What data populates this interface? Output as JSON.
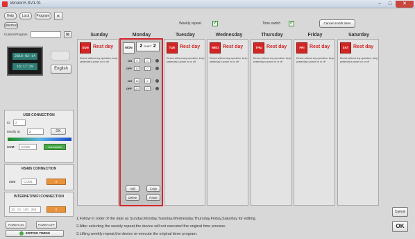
{
  "window": {
    "title": "VersionY-SV1.01",
    "min": "–",
    "max": "□",
    "close": "✕"
  },
  "left": {
    "help": "Help",
    "lock": "Lock",
    "program": "Program",
    "collapse": "«",
    "elements": "(Wetfox)",
    "current_program_label": "Current Program",
    "current_program_value": "",
    "current_program_btn": "⊠",
    "date": "2016-02-14",
    "time": "16:17:29",
    "gray_btn": "",
    "english": "English"
  },
  "usb": {
    "title": "USB CONNECTION",
    "id_label": "ID",
    "id_value": "2",
    "modify_label": "Modify ID",
    "modify_value": "2",
    "ok": "OK",
    "com_label": "COM",
    "com_value": "COM6",
    "connect": "Connected"
  },
  "rs485": {
    "title": "RS485 CONNECTION",
    "com_label": "com",
    "com_value": "COM1",
    "button": "0"
  },
  "wifi": {
    "title": "INTERNET/WIFI CONNECTION",
    "ip": "10 . 10 . 100 . 254",
    "button": "0"
  },
  "bottom_left": {
    "power_on": "POWER ON",
    "power_off": "POWER OFF",
    "editing_timing": "EDITING TIMING"
  },
  "top": {
    "weekly_repeat": "Weekly repeat",
    "time_switch": "Time switch",
    "cancel_week": "Cancel month timer"
  },
  "days": [
    {
      "name": "Sunday",
      "badge": "SUN",
      "rest": "Rest day",
      "desc": "Device without any operation, keep yesterday's power on or off"
    },
    {
      "name": "Monday",
      "badge": "MON",
      "tab_num": "2",
      "tab_sub": "SHIFT",
      "tab_num2": "2"
    },
    {
      "name": "Tuesday",
      "badge": "TUE",
      "rest": "Rest day",
      "desc": "Device without any operation, keep yesterday's power on or off"
    },
    {
      "name": "Wednesday",
      "badge": "WED",
      "rest": "Rest day",
      "desc": "Device without any operation, keep yesterday's power on or off"
    },
    {
      "name": "Thursday",
      "badge": "THU",
      "rest": "Rest day",
      "desc": "Device without any operation, keep yesterday's power on or off"
    },
    {
      "name": "Friday",
      "badge": "FRI",
      "rest": "Rest day",
      "desc": "Device without any operation, keep yesterday's power on or off"
    },
    {
      "name": "Saturday",
      "badge": "SAT",
      "rest": "Rest day",
      "desc": "Device without any operation, keep yesterday's power on or off"
    }
  ],
  "monday_times": [
    {
      "label": "ON",
      "h": "0",
      "m": "0"
    },
    {
      "label": "OFF",
      "h": "12",
      "m": "0"
    },
    {
      "label": "ON",
      "h": "14",
      "m": "0"
    },
    {
      "label": "OFF",
      "h": "22",
      "m": "0"
    }
  ],
  "monday_buttons": {
    "add": "Add",
    "copy": "Copy",
    "delete": "Delete",
    "paste": "Paste"
  },
  "notes": [
    "1.Follow in order of the date as Sunday,Monday,Tuesday,Wednesday,Thursday,Friday,Saturday for editing.",
    "2.After selecting the weekly repeat,the device will not executed the original time process.",
    "3.Lifting weekly repeat,the device re-execute the original timer program."
  ],
  "right": {
    "cancel": "Cancel",
    "ok": "OK"
  },
  "colors": {
    "red": "#d32424",
    "orange": "#e8923b",
    "green": "#4aa84a",
    "lcd": "#2f7d75"
  }
}
